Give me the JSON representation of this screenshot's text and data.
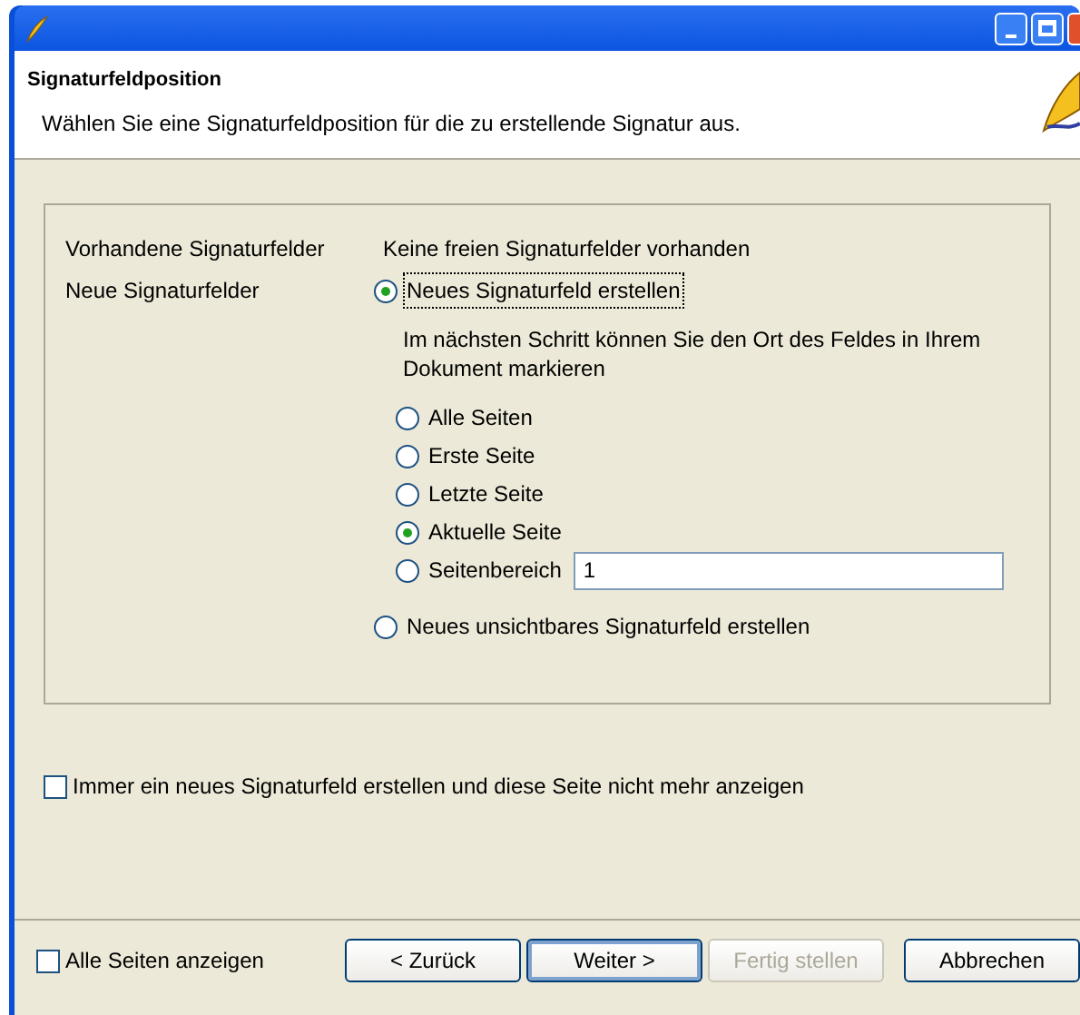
{
  "header": {
    "title": "Signaturfeldposition",
    "subtitle": "Wählen Sie eine Signaturfeldposition für die zu erstellende Signatur aus."
  },
  "existing": {
    "label": "Vorhandene Signaturfelder",
    "value": "Keine freien Signaturfelder vorhanden"
  },
  "new_fields": {
    "label": "Neue Signaturfelder",
    "modes": [
      {
        "label": "Neues Signaturfeld erstellen",
        "selected": true,
        "focused": true
      },
      {
        "label": "Neues unsichtbares Signaturfeld erstellen",
        "selected": false,
        "focused": false
      }
    ],
    "hint": "Im nächsten Schritt können Sie den Ort des Feldes in Ihrem Dokument markieren",
    "pages": [
      {
        "label": "Alle Seiten",
        "selected": false
      },
      {
        "label": "Erste Seite",
        "selected": false
      },
      {
        "label": "Letzte Seite",
        "selected": false
      },
      {
        "label": "Aktuelle Seite",
        "selected": true
      },
      {
        "label": "Seitenbereich",
        "selected": false,
        "value": "1"
      }
    ]
  },
  "always_new": {
    "label": "Immer ein neues Signaturfeld erstellen und diese Seite nicht mehr anzeigen",
    "checked": false
  },
  "show_all_pages": {
    "label": "Alle Seiten anzeigen",
    "checked": false
  },
  "buttons": [
    {
      "label": "< Zurück",
      "disabled": false,
      "default": false
    },
    {
      "label": "Weiter >",
      "disabled": false,
      "default": true
    },
    {
      "label": "Fertig stellen",
      "disabled": true,
      "default": false
    },
    {
      "label": "Abbrechen",
      "disabled": false,
      "default": false
    }
  ]
}
